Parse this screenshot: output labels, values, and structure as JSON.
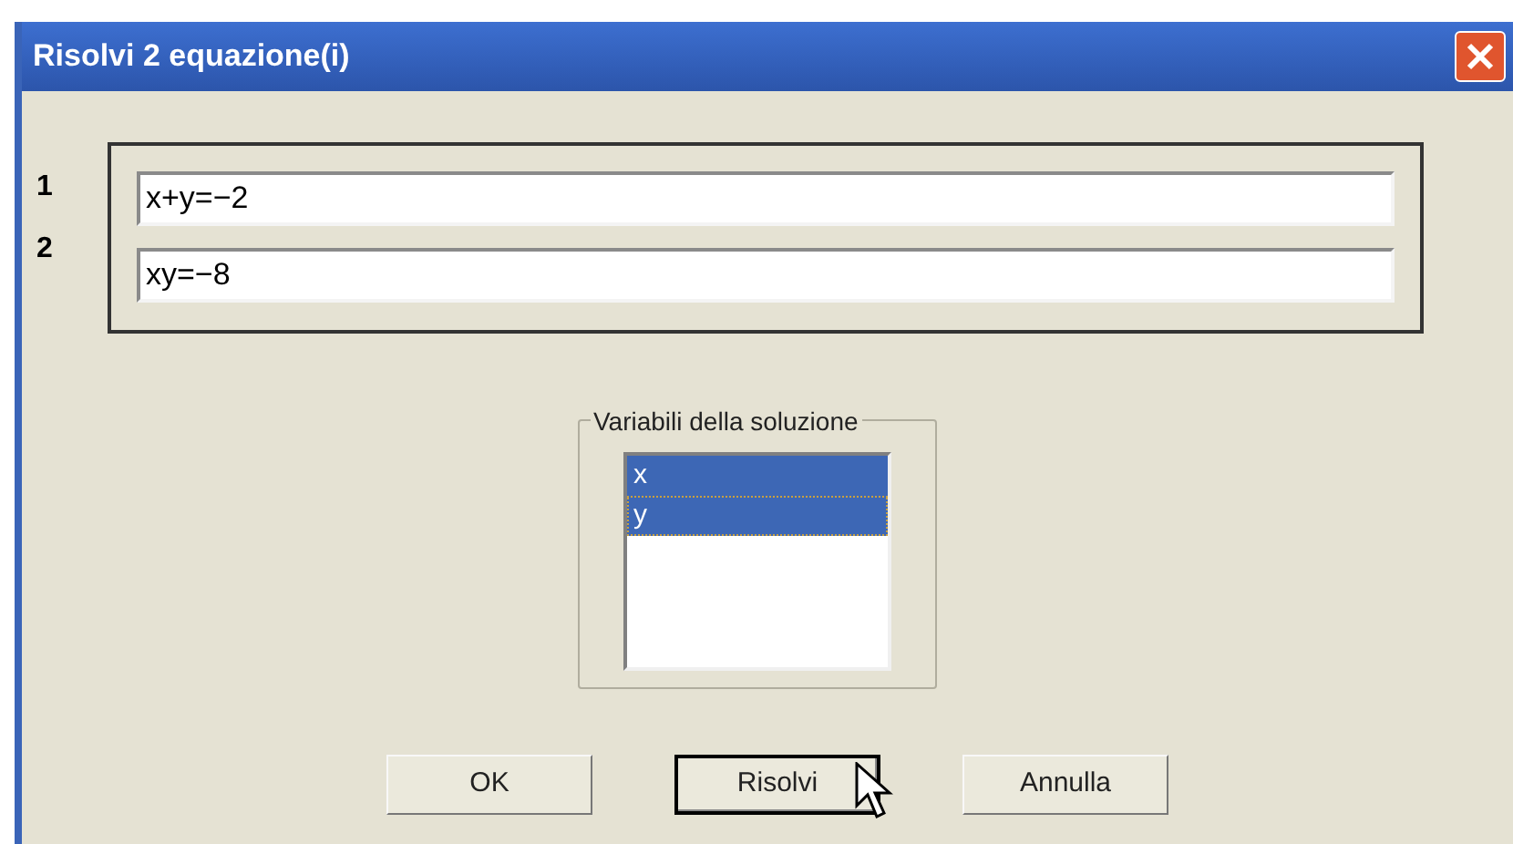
{
  "window": {
    "title": "Risolvi 2 equazione(i)"
  },
  "equations": [
    {
      "number": "1",
      "value": "x+y=−2"
    },
    {
      "number": "2",
      "value": "xy=−8"
    }
  ],
  "variables": {
    "label": "Variabili della soluzione",
    "items": [
      {
        "label": "x",
        "selected": true,
        "focused": false
      },
      {
        "label": "y",
        "selected": true,
        "focused": true
      }
    ]
  },
  "buttons": [
    {
      "label": "OK",
      "default": false
    },
    {
      "label": "Risolvi",
      "default": true
    },
    {
      "label": "Annulla",
      "default": false
    }
  ]
}
